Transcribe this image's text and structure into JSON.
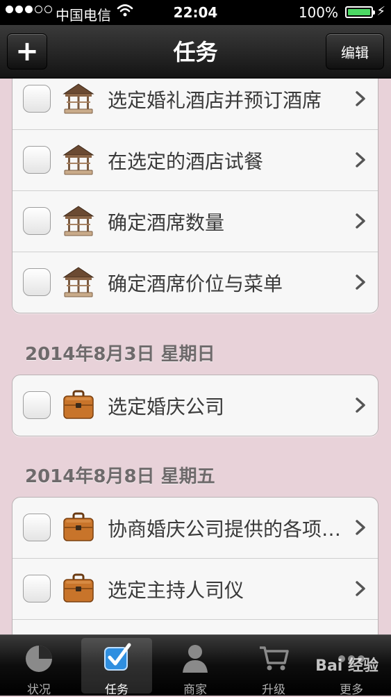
{
  "status_bar": {
    "carrier": "中国电信",
    "time": "22:04",
    "battery_percent": "100%",
    "battery_level": 1.0,
    "signal_bars_filled": 3,
    "signal_bars_total": 5
  },
  "nav": {
    "title": "任务",
    "add_label": "+",
    "edit_label": "编辑"
  },
  "groups": [
    {
      "items": [
        {
          "label": "选定婚礼酒店并预订酒席",
          "icon": "pavilion-icon"
        },
        {
          "label": "在选定的酒店试餐",
          "icon": "pavilion-icon"
        },
        {
          "label": "确定酒席数量",
          "icon": "pavilion-icon"
        },
        {
          "label": "确定酒席价位与菜单",
          "icon": "pavilion-icon"
        }
      ]
    },
    {
      "header": "2014年8月3日  星期日",
      "items": [
        {
          "label": "选定婚庆公司",
          "icon": "briefcase-icon"
        }
      ]
    },
    {
      "header": "2014年8月8日  星期五",
      "items": [
        {
          "label": "协商婚庆公司提供的各项服务",
          "icon": "briefcase-icon"
        },
        {
          "label": "选定主持人司仪",
          "icon": "briefcase-icon"
        }
      ]
    }
  ],
  "tabs": [
    {
      "label": "状况",
      "icon": "pie-chart-icon",
      "active": false
    },
    {
      "label": "任务",
      "icon": "checkbox-icon",
      "active": true
    },
    {
      "label": "商家",
      "icon": "person-icon",
      "active": false
    },
    {
      "label": "升级",
      "icon": "cart-icon",
      "active": false
    },
    {
      "label": "更多",
      "icon": "more-icon",
      "active": false
    }
  ],
  "watermark": "Bai 经验",
  "colors": {
    "background": "#e8d2d9",
    "active_tab_icon": "#2f8fe0",
    "battery_fill": "#4cd964"
  }
}
